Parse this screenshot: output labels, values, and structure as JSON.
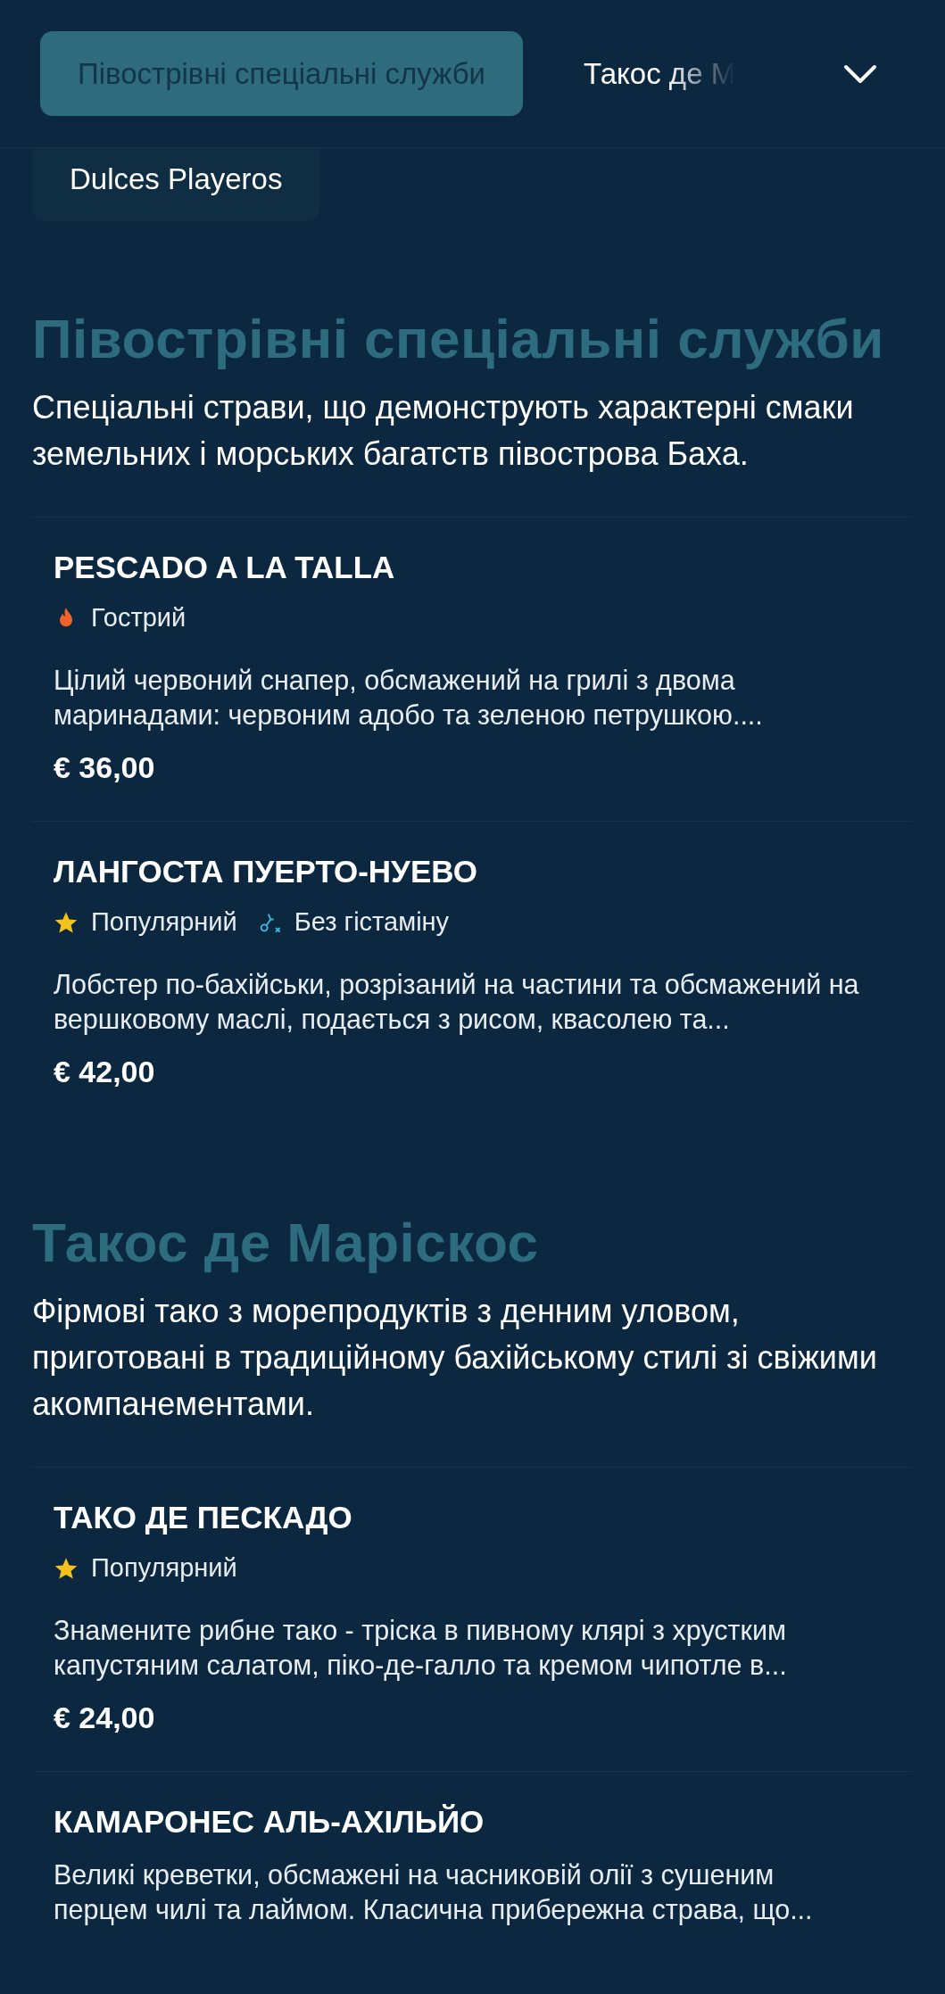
{
  "nav": {
    "tabs": [
      {
        "label": "Півострівні спеціальні служби",
        "selected": true
      },
      {
        "label": "Такос де М",
        "selected": false
      }
    ],
    "chip": "Dulces Playeros"
  },
  "sections": [
    {
      "title": "Півострівні спеціальні служби",
      "description": "Спеціальні страви, що демонструють характерні смаки земельних і морських багатств півострова Баха.",
      "items": [
        {
          "name": "PESCADO A LA TALLA",
          "tags": [
            {
              "kind": "spicy",
              "label": "Гострий"
            }
          ],
          "description": "Цілий червоний снапер, обсмажений на грилі з двома маринадами: червоним адобо та зеленою петрушкою....",
          "price": "€ 36,00"
        },
        {
          "name": "ЛАНГОСТА ПУЕРТО-НУЕВО",
          "tags": [
            {
              "kind": "popular",
              "label": "Популярний"
            },
            {
              "kind": "histamine_free",
              "label": "Без гістаміну"
            }
          ],
          "description": "Лобстер по-бахійськи, розрізаний на частини та обсмажений на вершковому маслі, подається з рисом, квасолею та...",
          "price": "€ 42,00"
        }
      ]
    },
    {
      "title": "Такос де Маріскос",
      "description": "Фірмові тако з морепродуктів з денним уловом, приготовані в традиційному бахійському стилі зі свіжими акомпанементами.",
      "items": [
        {
          "name": "ТАКО ДЕ ПЕСКАДО",
          "tags": [
            {
              "kind": "popular",
              "label": "Популярний"
            }
          ],
          "description": "Знамените рибне тако - тріска в пивному клярі з хрустким капустяним салатом, піко-де-галло та кремом чипотле в...",
          "price": "€ 24,00"
        },
        {
          "name": "КАМАРОНЕС АЛЬ-АХІЛЬЙО",
          "description": "Великі креветки, обсмажені на часниковій олії з сушеним перцем чилі та лаймом. Класична прибережна страва, що..."
        }
      ]
    }
  ]
}
